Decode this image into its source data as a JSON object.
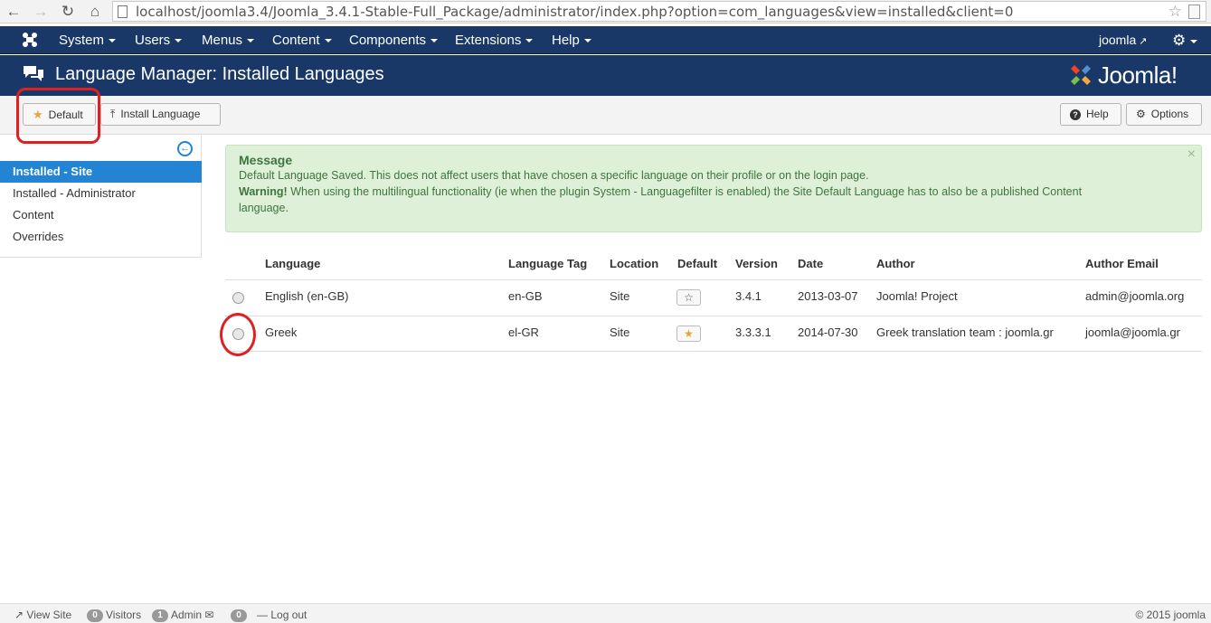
{
  "browser": {
    "url": "localhost/joomla3.4/Joomla_3.4.1-Stable-Full_Package/administrator/index.php?option=com_languages&view=installed&client=0"
  },
  "topnav": {
    "menus": [
      "System",
      "Users",
      "Menus",
      "Content",
      "Components",
      "Extensions",
      "Help"
    ],
    "user": "joomla"
  },
  "header": {
    "title": "Language Manager: Installed Languages",
    "brand": "Joomla!"
  },
  "toolbar": {
    "default_label": "Default",
    "install_label": "Install Language",
    "help_label": "Help",
    "options_label": "Options"
  },
  "sidebar": {
    "items": [
      "Installed - Site",
      "Installed - Administrator",
      "Content",
      "Overrides"
    ],
    "active_index": 0
  },
  "alert": {
    "heading": "Message",
    "line1": "Default Language Saved. This does not affect users that have chosen a specific language on their profile or on the login page.",
    "warning_label": "Warning!",
    "line2": "When using the multilingual functionality (ie when the plugin System - Languagefilter is enabled) the Site Default Language has to also be a published Content",
    "line3": "language."
  },
  "table": {
    "columns": [
      "Language",
      "Language Tag",
      "Location",
      "Default",
      "Version",
      "Date",
      "Author",
      "Author Email"
    ],
    "rows": [
      {
        "language": "English (en-GB)",
        "tag": "en-GB",
        "location": "Site",
        "is_default": false,
        "version": "3.4.1",
        "date": "2013-03-07",
        "author": "Joomla! Project",
        "email": "admin@joomla.org"
      },
      {
        "language": "Greek",
        "tag": "el-GR",
        "location": "Site",
        "is_default": true,
        "version": "3.3.3.1",
        "date": "2014-07-30",
        "author": "Greek translation team : joomla.gr",
        "email": "joomla@joomla.gr"
      }
    ]
  },
  "statusbar": {
    "view_site": "View Site",
    "visitors_count": "0",
    "visitors_label": "Visitors",
    "admin_count": "1",
    "admin_label": "Admin",
    "messages_count": "0",
    "logout": "Log out",
    "copyright": "© 2015 joomla"
  },
  "colors": {
    "navy": "#1a3867",
    "accent_blue": "#2384d3",
    "alert_green": "#dff0d8",
    "star_orange": "#e8a33d",
    "annotation_red": "#e02020"
  }
}
